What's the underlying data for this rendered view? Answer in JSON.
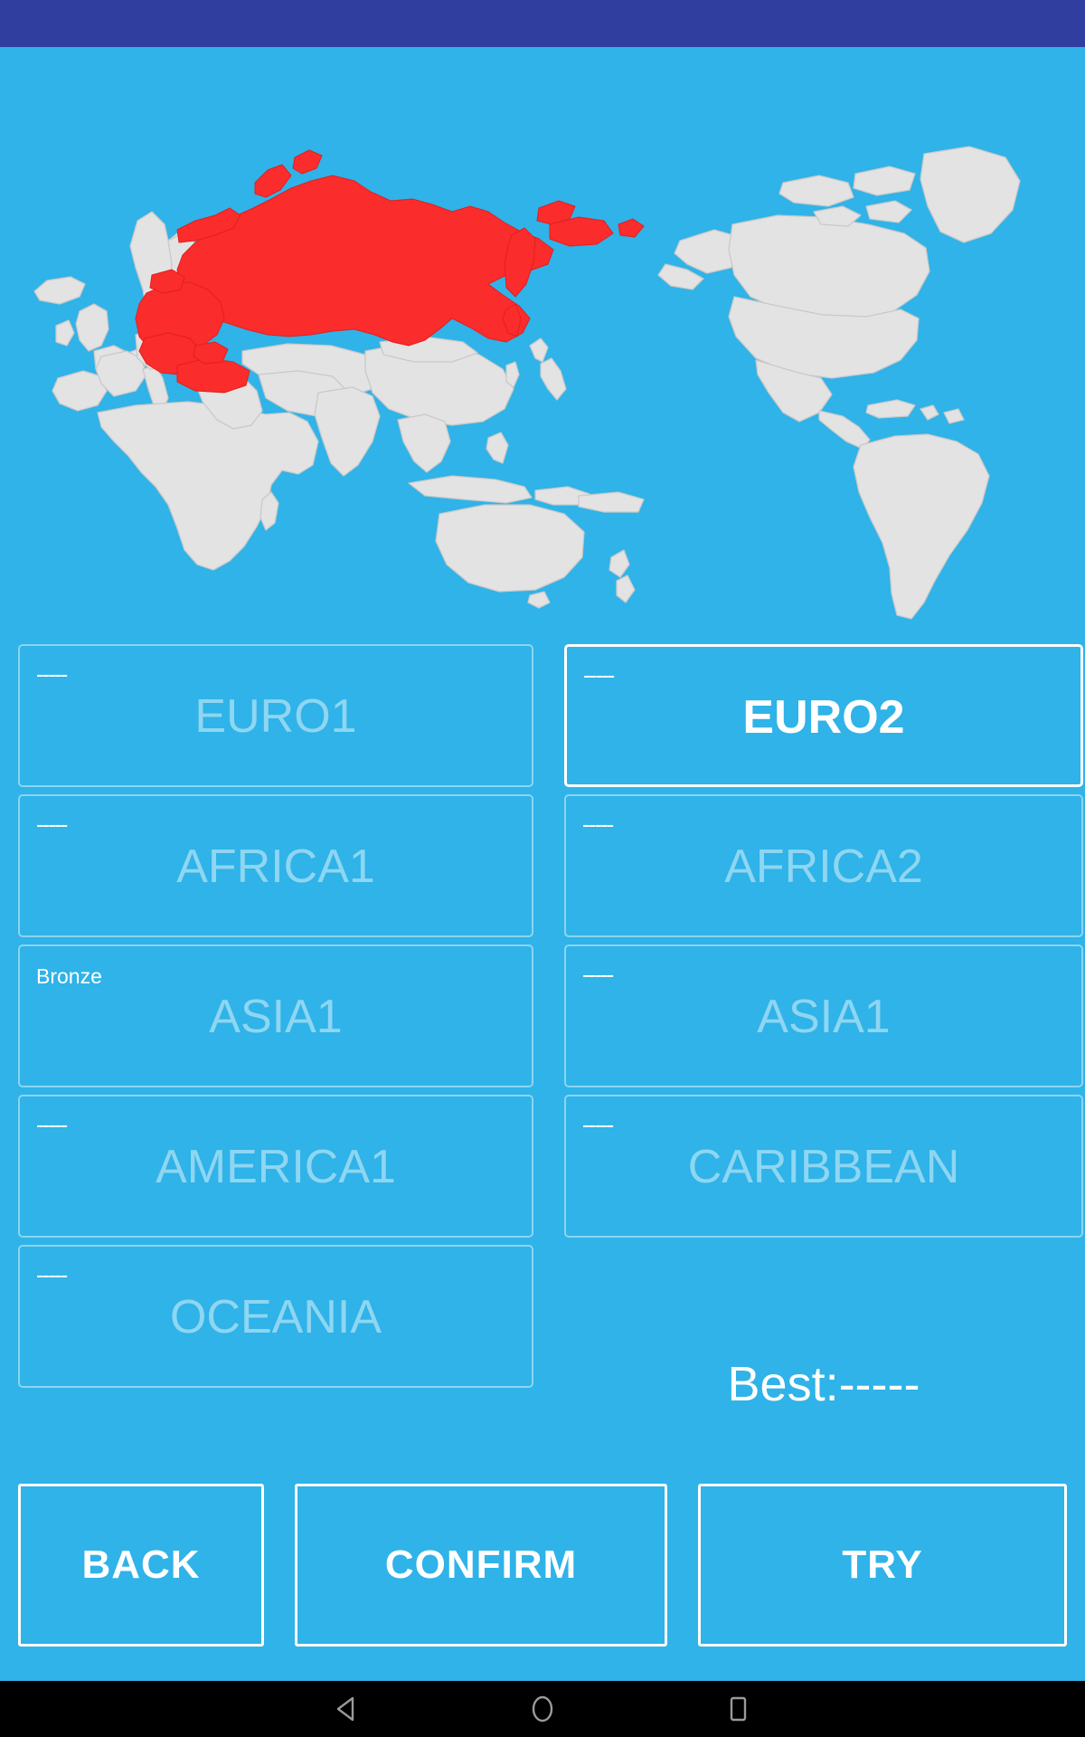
{
  "status_bar": {
    "color": "#303F9F"
  },
  "theme": {
    "background": "#2FB3E8",
    "land": "#E3E3E3",
    "land_stroke": "#C9C9C9",
    "highlight": "#FA2C2C",
    "text_dim": "rgba(255,255,255,0.46)",
    "text_active": "#FFFFFF"
  },
  "map": {
    "name": "world-map",
    "highlighted_region": "Eastern Europe and Russia",
    "highlight_color": "#FA2C2C",
    "land_color": "#E3E3E3",
    "ocean_color": "#2FB3E8"
  },
  "regions": [
    {
      "badge": "-----",
      "badge_type": "dashes",
      "label": "EURO1",
      "active": false
    },
    {
      "badge": "-----",
      "badge_type": "dashes",
      "label": "EURO2",
      "active": true
    },
    {
      "badge": "-----",
      "badge_type": "dashes",
      "label": "AFRICA1",
      "active": false
    },
    {
      "badge": "-----",
      "badge_type": "dashes",
      "label": "AFRICA2",
      "active": false
    },
    {
      "badge": "Bronze",
      "badge_type": "text",
      "label": "ASIA1",
      "active": false
    },
    {
      "badge": "-----",
      "badge_type": "dashes",
      "label": "ASIA1",
      "active": false
    },
    {
      "badge": "-----",
      "badge_type": "dashes",
      "label": "AMERICA1",
      "active": false
    },
    {
      "badge": "-----",
      "badge_type": "dashes",
      "label": "CARIBBEAN",
      "active": false
    },
    {
      "badge": "-----",
      "badge_type": "dashes",
      "label": "OCEANIA",
      "active": false
    }
  ],
  "best_score": {
    "label": "Best:-----"
  },
  "actions": {
    "back": "BACK",
    "confirm": "CONFIRM",
    "try": "TRY"
  },
  "nav_bar": {
    "back_icon": "triangle-back-icon",
    "home_icon": "circle-home-icon",
    "recents_icon": "square-recents-icon"
  }
}
